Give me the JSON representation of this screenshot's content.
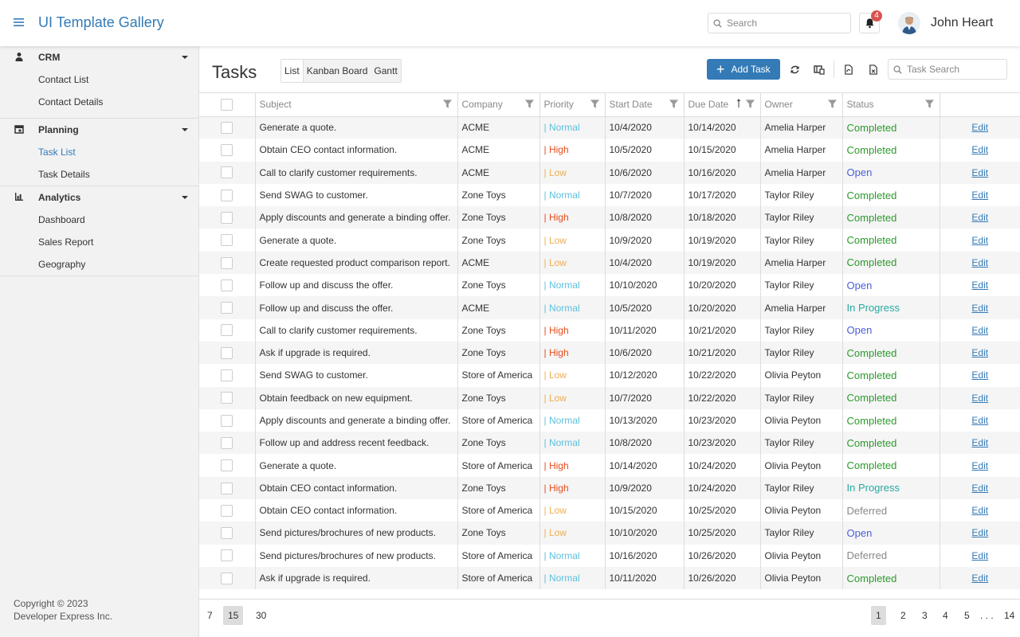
{
  "header": {
    "app_title": "UI Template Gallery",
    "search_placeholder": "Search",
    "notification_count": "4",
    "user_name": "John Heart"
  },
  "sidebar": {
    "groups": [
      {
        "label": "CRM",
        "icon": "person-icon",
        "items": [
          {
            "label": "Contact List"
          },
          {
            "label": "Contact Details"
          }
        ]
      },
      {
        "label": "Planning",
        "icon": "calendar-icon",
        "items": [
          {
            "label": "Task List",
            "active": true
          },
          {
            "label": "Task Details"
          }
        ]
      },
      {
        "label": "Analytics",
        "icon": "bar-chart-icon",
        "items": [
          {
            "label": "Dashboard"
          },
          {
            "label": "Sales Report"
          },
          {
            "label": "Geography"
          }
        ]
      }
    ],
    "copyright_line1": "Copyright © 2023",
    "copyright_line2": "Developer Express Inc."
  },
  "main": {
    "title": "Tasks",
    "tabs": [
      {
        "label": "List",
        "active": true
      },
      {
        "label": "Kanban Board"
      },
      {
        "label": "Gantt"
      }
    ],
    "add_task_label": "Add Task",
    "task_search_placeholder": "Task Search"
  },
  "grid": {
    "columns": [
      "Subject",
      "Company",
      "Priority",
      "Start Date",
      "Due Date",
      "Owner",
      "Status"
    ],
    "sorted_column": "Due Date",
    "edit_label": "Edit",
    "rows": [
      [
        "Generate a quote.",
        "ACME",
        "Normal",
        "10/4/2020",
        "10/14/2020",
        "Amelia Harper",
        "Completed"
      ],
      [
        "Obtain CEO contact information.",
        "ACME",
        "High",
        "10/5/2020",
        "10/15/2020",
        "Amelia Harper",
        "Completed"
      ],
      [
        "Call to clarify customer requirements.",
        "ACME",
        "Low",
        "10/6/2020",
        "10/16/2020",
        "Amelia Harper",
        "Open"
      ],
      [
        "Send SWAG to customer.",
        "Zone Toys",
        "Normal",
        "10/7/2020",
        "10/17/2020",
        "Taylor Riley",
        "Completed"
      ],
      [
        "Apply discounts and generate a binding offer.",
        "Zone Toys",
        "High",
        "10/8/2020",
        "10/18/2020",
        "Taylor Riley",
        "Completed"
      ],
      [
        "Generate a quote.",
        "Zone Toys",
        "Low",
        "10/9/2020",
        "10/19/2020",
        "Taylor Riley",
        "Completed"
      ],
      [
        "Create requested product comparison report.",
        "ACME",
        "Low",
        "10/4/2020",
        "10/19/2020",
        "Amelia Harper",
        "Completed"
      ],
      [
        "Follow up and discuss the offer.",
        "Zone Toys",
        "Normal",
        "10/10/2020",
        "10/20/2020",
        "Taylor Riley",
        "Open"
      ],
      [
        "Follow up and discuss the offer.",
        "ACME",
        "Normal",
        "10/5/2020",
        "10/20/2020",
        "Amelia Harper",
        "In Progress"
      ],
      [
        "Call to clarify customer requirements.",
        "Zone Toys",
        "High",
        "10/11/2020",
        "10/21/2020",
        "Taylor Riley",
        "Open"
      ],
      [
        "Ask if upgrade is required.",
        "Zone Toys",
        "High",
        "10/6/2020",
        "10/21/2020",
        "Taylor Riley",
        "Completed"
      ],
      [
        "Send SWAG to customer.",
        "Store of America",
        "Low",
        "10/12/2020",
        "10/22/2020",
        "Olivia Peyton",
        "Completed"
      ],
      [
        "Obtain feedback on new equipment.",
        "Zone Toys",
        "Low",
        "10/7/2020",
        "10/22/2020",
        "Taylor Riley",
        "Completed"
      ],
      [
        "Apply discounts and generate a binding offer.",
        "Store of America",
        "Normal",
        "10/13/2020",
        "10/23/2020",
        "Olivia Peyton",
        "Completed"
      ],
      [
        "Follow up and address recent feedback.",
        "Zone Toys",
        "Normal",
        "10/8/2020",
        "10/23/2020",
        "Taylor Riley",
        "Completed"
      ],
      [
        "Generate a quote.",
        "Store of America",
        "High",
        "10/14/2020",
        "10/24/2020",
        "Olivia Peyton",
        "Completed"
      ],
      [
        "Obtain CEO contact information.",
        "Zone Toys",
        "High",
        "10/9/2020",
        "10/24/2020",
        "Taylor Riley",
        "In Progress"
      ],
      [
        "Obtain CEO contact information.",
        "Store of America",
        "Low",
        "10/15/2020",
        "10/25/2020",
        "Olivia Peyton",
        "Deferred"
      ],
      [
        "Send pictures/brochures of new products.",
        "Zone Toys",
        "Low",
        "10/10/2020",
        "10/25/2020",
        "Taylor Riley",
        "Open"
      ],
      [
        "Send pictures/brochures of new products.",
        "Store of America",
        "Normal",
        "10/16/2020",
        "10/26/2020",
        "Olivia Peyton",
        "Deferred"
      ],
      [
        "Ask if upgrade is required.",
        "Store of America",
        "Normal",
        "10/11/2020",
        "10/26/2020",
        "Olivia Peyton",
        "Completed"
      ]
    ]
  },
  "pager": {
    "page_sizes": [
      "7",
      "15",
      "30"
    ],
    "active_page_size": "15",
    "pages": [
      "1",
      "2",
      "3",
      "4",
      "5",
      ". . .",
      "14"
    ],
    "active_page": "1"
  },
  "colors": {
    "accent": "#337ab7",
    "priority_normal": "#5bc0de",
    "priority_high": "#e74c1c",
    "priority_low": "#f0ad4e",
    "status_completed": "#2c9a2c",
    "status_open": "#4a5fd9",
    "status_in_progress": "#28a9a0",
    "status_deferred": "#888888",
    "badge": "#d9534f"
  }
}
